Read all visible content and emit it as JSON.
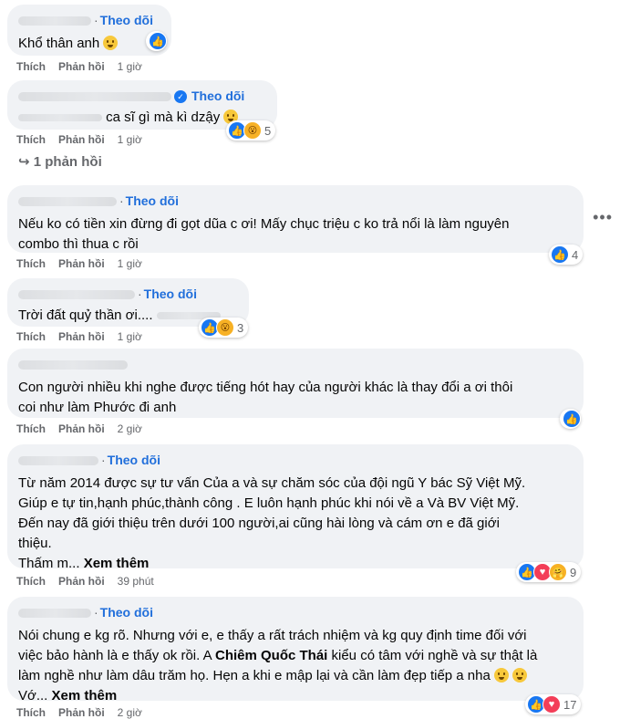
{
  "labels": {
    "follow": "Theo dõi",
    "like": "Thích",
    "reply": "Phản hồi",
    "see_more": "Xem thêm",
    "more_menu": "•••"
  },
  "comments": [
    {
      "text": "Khổ thân anh",
      "time": "1 giờ",
      "reactions": null
    },
    {
      "text": "ca sĩ gì mà kì dzậy",
      "time": "1 giờ",
      "reactions": "5"
    },
    {
      "text": "Nếu ko có tiền xin đừng đi gọt dũa c ơi! Mấy chục triệu c ko trả nổi là làm nguyên\ncombo thì thua c rồi",
      "time": "1 giờ",
      "reactions": "4"
    },
    {
      "text": "Trời đất quỷ thần ơi....",
      "time": "1 giờ",
      "reactions": "3"
    },
    {
      "text": "Con người nhiều khi nghe được tiếng hót hay của người khác là thay đổi a ơi thôi\ncoi như làm Phước đi anh",
      "time": "2 giờ",
      "reactions": ""
    },
    {
      "text": "Từ năm 2014 được sự tư vấn Của a và sự chăm sóc của đội ngũ Y bác Sỹ Việt Mỹ.\nGiúp e tự tin,hạnh phúc,thành công . E luôn hạnh phúc khi nói về a Và BV Việt Mỹ.\nĐến nay đã giới thiệu trên dưới 100 người,ai cũng hài lòng và cám ơn e đã giới\nthiệu.",
      "preview": "Thấm m... ",
      "time": "39 phút",
      "reactions": "9"
    },
    {
      "text_1": "Nói chung e kg rõ. Nhưng với e, e thấy a rất trách nhiệm và kg quy định time đối với\nviệc bảo hành là e thấy ok rồi. A ",
      "bold_name": "Chiêm Quốc Thái",
      "text_2": " kiểu có tâm với nghề và sự thật là\nlàm nghề như làm dâu trăm họ. Hẹn a khi e mập lại và cần làm đẹp tiếp a nha ",
      "preview": "Vớ... ",
      "time": "2 giờ",
      "reactions": "17"
    }
  ],
  "replies_link": "↪ 1 phản hồi"
}
